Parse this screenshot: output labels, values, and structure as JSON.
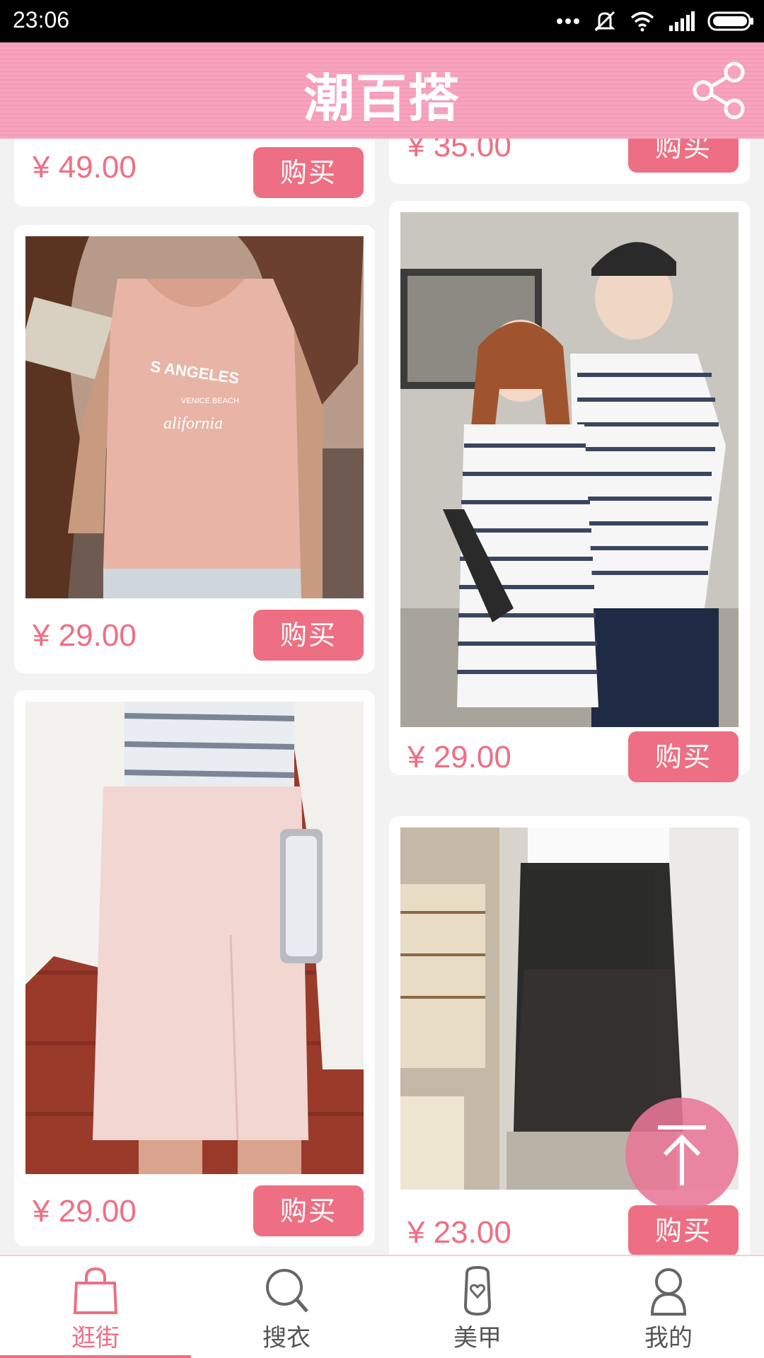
{
  "status_bar": {
    "time": "23:06"
  },
  "header": {
    "logo": "潮百搭"
  },
  "products": [
    {
      "price": "¥ 49.00",
      "buy_label": "购买"
    },
    {
      "price": "¥ 35.00",
      "buy_label": "购买"
    },
    {
      "price": "¥ 29.00",
      "buy_label": "购买"
    },
    {
      "price": "¥ 29.00",
      "buy_label": "购买"
    },
    {
      "price": "¥ 29.00",
      "buy_label": "购买"
    },
    {
      "price": "¥ 23.00",
      "buy_label": "购买"
    }
  ],
  "photo_text": {
    "line1": "S ANGELES",
    "line2": "VENICE BEACH",
    "line3": "alifornia"
  },
  "bottom_nav": [
    {
      "label": "逛街",
      "icon": "shopping-bag-icon",
      "active": true
    },
    {
      "label": "搜衣",
      "icon": "search-icon",
      "active": false
    },
    {
      "label": "美甲",
      "icon": "nail-icon",
      "active": false
    },
    {
      "label": "我的",
      "icon": "person-icon",
      "active": false
    }
  ],
  "colors": {
    "accent": "#ee6f83",
    "header": "#f7a3bd"
  }
}
